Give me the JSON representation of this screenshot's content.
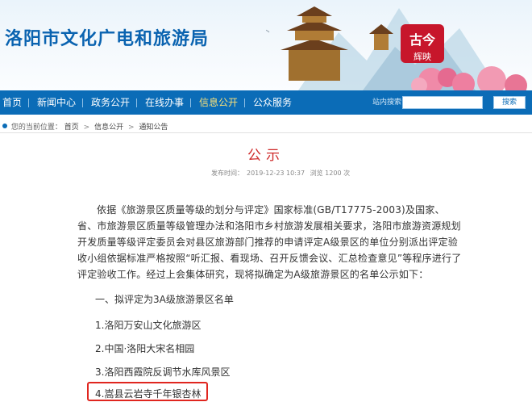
{
  "header": {
    "site_title": "洛阳市文化广电和旅游局",
    "badge_main": "古今",
    "badge_sub": "辉映"
  },
  "nav": {
    "items": [
      {
        "label": "首页"
      },
      {
        "label": "新闻中心"
      },
      {
        "label": "政务公开"
      },
      {
        "label": "在线办事"
      },
      {
        "label": "信息公开",
        "active": true
      },
      {
        "label": "公众服务"
      }
    ],
    "search_label": "站内搜索",
    "search_placeholder": "",
    "search_button": "搜索"
  },
  "breadcrumb": {
    "prefix": "您的当前位置：",
    "items": [
      "首页",
      "信息公开",
      "通知公告"
    ],
    "separator": ">"
  },
  "article": {
    "title": "公示",
    "meta": {
      "published_label": "发布时间：",
      "published": "2019-12-23 10:37",
      "views": "浏览 1200 次"
    },
    "body": "依据《旅游景区质量等级的划分与评定》国家标准(GB/T17775-2003)及国家、省、市旅游景区质量等级管理办法和洛阳市乡村旅游发展相关要求，洛阳市旅游资源规划开发质量等级评定委员会对县区旅游部门推荐的申请评定A级景区的单位分别派出评定验收小组依据标准严格按照“听汇报、看现场、召开反馈会议、汇总检查意见”等程序进行了评定验收工作。经过上会集体研究，现将拟确定为A级旅游景区的名单公示如下：",
    "section_heading": "一、拟评定为3A级旅游景区名单",
    "list": [
      "1.洛阳万安山文化旅游区",
      "2.中国·洛阳大宋名相园",
      "3.洛阳西霞院反调节水库风景区",
      "4.嵩县云岩寺千年银杏林"
    ]
  },
  "colors": {
    "brand_blue": "#0b6cb7",
    "title_red": "#cf2a2a",
    "highlight_red": "#e0261f",
    "nav_active": "#f9e17a"
  }
}
